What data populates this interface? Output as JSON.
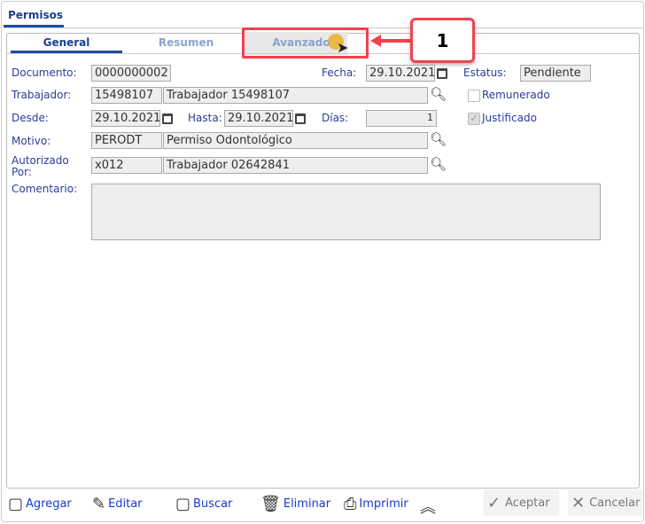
{
  "title": "Permisos",
  "tabs": [
    {
      "label": "General"
    },
    {
      "label": "Resumen"
    },
    {
      "label": "Avanzado"
    }
  ],
  "callout": "1",
  "form": {
    "documento_label": "Documento:",
    "documento": "0000000002",
    "fecha_label": "Fecha:",
    "fecha": "29.10.2021",
    "estatus_label": "Estatus:",
    "estatus": "Pendiente",
    "trabajador_label": "Trabajador:",
    "trabajador_code": "15498107",
    "trabajador_name": "Trabajador 15498107",
    "remunerado_label": "Remunerado",
    "remunerado": false,
    "desde_label": "Desde:",
    "desde": "29.10.2021",
    "hasta_label": "Hasta:",
    "hasta": "29.10.2021",
    "dias_label": "Días:",
    "dias": "1",
    "justificado_label": "Justificado",
    "justificado": true,
    "motivo_label": "Motivo:",
    "motivo_code": "PERODT",
    "motivo_name": "Permiso Odontológico",
    "autorizado_label": "Autorizado Por:",
    "autorizado_code": "x012",
    "autorizado_name": "Trabajador 02642841",
    "comentario_label": "Comentario:",
    "comentario": ""
  },
  "toolbar": {
    "agregar": "Agregar",
    "editar": "Editar",
    "buscar": "Buscar",
    "eliminar": "Eliminar",
    "imprimir": "Imprimir",
    "aceptar": "Aceptar",
    "cancelar": "Cancelar"
  },
  "colors": {
    "accent": "#1a4fa0",
    "label": "#2a3c9a",
    "highlight": "#f0434d"
  }
}
